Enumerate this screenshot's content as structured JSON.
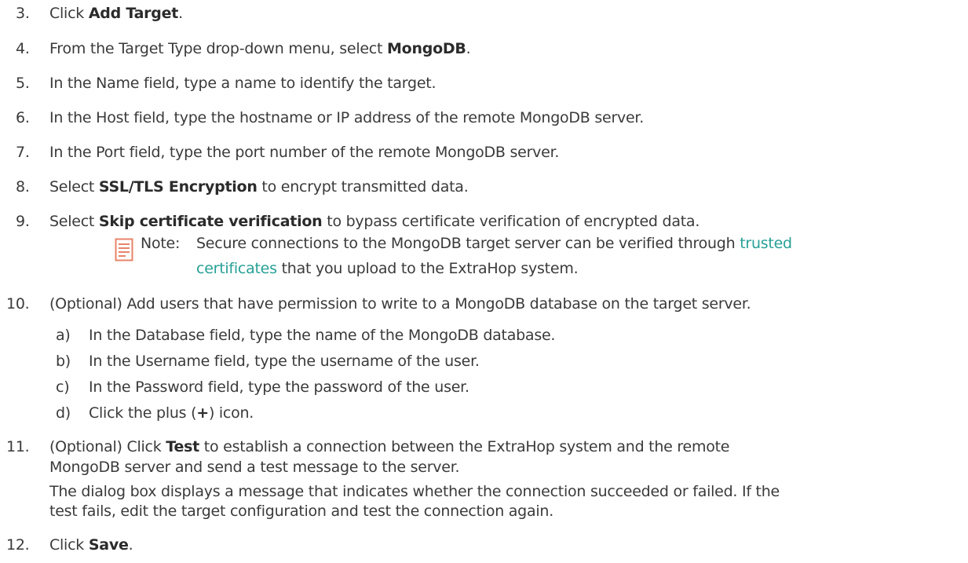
{
  "steps": [
    {
      "num": "3.",
      "pre": "Click ",
      "bold": "Add Target",
      "post": "."
    },
    {
      "num": "4.",
      "pre": "From the Target Type drop-down menu, select ",
      "bold": "MongoDB",
      "post": "."
    },
    {
      "num": "5.",
      "text": "In the Name field, type a name to identify the target."
    },
    {
      "num": "6.",
      "text": "In the Host field, type the hostname or IP address of the remote MongoDB server."
    },
    {
      "num": "7.",
      "text": "In the Port field, type the port number of the remote MongoDB server."
    },
    {
      "num": "8.",
      "pre": "Select ",
      "bold": "SSL/TLS Encryption",
      "post": " to encrypt transmitted data."
    },
    {
      "num": "9.",
      "pre": "Select ",
      "bold": "Skip certificate verification",
      "post": " to bypass certificate verification of encrypted data."
    },
    {
      "num": "10.",
      "text": "(Optional) Add users that have permission to write to a MongoDB database on the target server."
    },
    {
      "num": "11.",
      "pre": "(Optional) Click ",
      "bold": "Test",
      "post": " to establish a connection between the ExtraHop system and the remote",
      "cont": [
        "MongoDB server and send a test message to the server.",
        "The dialog box displays a message that indicates whether the connection succeeded or failed. If the",
        "test fails, edit the target configuration and test the connection again."
      ]
    },
    {
      "num": "12.",
      "pre": "Click ",
      "bold": "Save",
      "post": "."
    }
  ],
  "note": {
    "label": "Note:",
    "line1_pre": "Secure connections to the MongoDB target server can be verified through ",
    "line1_link": "trusted",
    "line2_link": "certificates",
    "line2_post": " that you upload to the ExtraHop system.",
    "icon": "note-document-icon",
    "icon_color": "#e8836a"
  },
  "substeps": [
    {
      "num": "a)",
      "text": "In the Database field, type the name of the MongoDB database."
    },
    {
      "num": "b)",
      "text": "In the Username field, type the username of the user."
    },
    {
      "num": "c)",
      "text": "In the Password field, type the password of the user."
    },
    {
      "num": "d)",
      "pre": "Click the plus (",
      "bold": "+",
      "post": ") icon."
    }
  ],
  "colors": {
    "text": "#3a3a3a",
    "link": "#27a096"
  }
}
